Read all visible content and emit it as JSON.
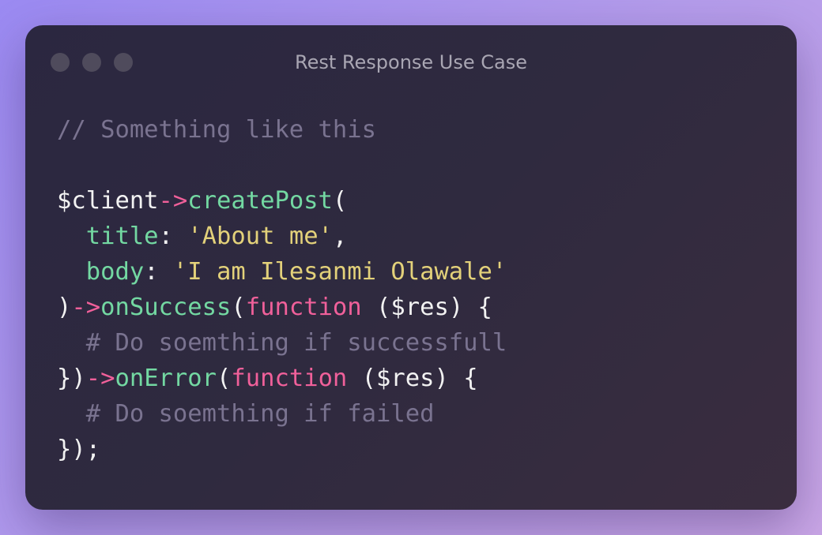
{
  "window": {
    "title": "Rest Response Use Case",
    "controls": [
      "close",
      "minimize",
      "maximize"
    ]
  },
  "code": {
    "language": "php",
    "lines": [
      {
        "tokens": [
          {
            "t": "// Something like this",
            "k": "comment"
          }
        ]
      },
      {
        "tokens": []
      },
      {
        "tokens": [
          {
            "t": "$client",
            "k": "plain"
          },
          {
            "t": "->",
            "k": "operator"
          },
          {
            "t": "createPost",
            "k": "function"
          },
          {
            "t": "(",
            "k": "plain"
          }
        ]
      },
      {
        "tokens": [
          {
            "t": "  ",
            "k": "plain"
          },
          {
            "t": "title",
            "k": "property"
          },
          {
            "t": ": ",
            "k": "plain"
          },
          {
            "t": "'About me'",
            "k": "string"
          },
          {
            "t": ",",
            "k": "plain"
          }
        ]
      },
      {
        "tokens": [
          {
            "t": "  ",
            "k": "plain"
          },
          {
            "t": "body",
            "k": "property"
          },
          {
            "t": ": ",
            "k": "plain"
          },
          {
            "t": "'I am Ilesanmi Olawale'",
            "k": "string"
          }
        ]
      },
      {
        "tokens": [
          {
            "t": ")",
            "k": "plain"
          },
          {
            "t": "->",
            "k": "operator"
          },
          {
            "t": "onSuccess",
            "k": "function"
          },
          {
            "t": "(",
            "k": "plain"
          },
          {
            "t": "function",
            "k": "keyword"
          },
          {
            "t": " ($res) {",
            "k": "plain"
          }
        ]
      },
      {
        "tokens": [
          {
            "t": "  # Do soemthing if successfull",
            "k": "comment"
          }
        ]
      },
      {
        "tokens": [
          {
            "t": "})",
            "k": "plain"
          },
          {
            "t": "->",
            "k": "operator"
          },
          {
            "t": "onError",
            "k": "function"
          },
          {
            "t": "(",
            "k": "plain"
          },
          {
            "t": "function",
            "k": "keyword"
          },
          {
            "t": " ($res) {",
            "k": "plain"
          }
        ]
      },
      {
        "tokens": [
          {
            "t": "  # Do soemthing if failed",
            "k": "comment"
          }
        ]
      },
      {
        "tokens": [
          {
            "t": "});",
            "k": "plain"
          }
        ]
      }
    ]
  },
  "colors": {
    "comment": "#7a7390",
    "plain": "#f2f2f2",
    "operator": "#f0609a",
    "function": "#73d8a2",
    "keyword": "#f0609a",
    "string": "#e3d17a",
    "property": "#73d8a2"
  }
}
